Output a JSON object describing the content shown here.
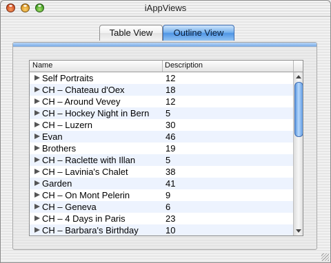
{
  "window": {
    "title": "iAppViews"
  },
  "tabs": {
    "table_label": "Table View",
    "outline_label": "Outline View"
  },
  "table": {
    "columns": [
      "Name",
      "Description"
    ],
    "rows": [
      {
        "name": "Self Portraits",
        "value": "12"
      },
      {
        "name": "CH – Chateau d'Oex",
        "value": "18"
      },
      {
        "name": "CH – Around Vevey",
        "value": "12"
      },
      {
        "name": "CH – Hockey Night in Bern",
        "value": "5"
      },
      {
        "name": "CH – Luzern",
        "value": "30"
      },
      {
        "name": "Evan",
        "value": "46"
      },
      {
        "name": "Brothers",
        "value": "19"
      },
      {
        "name": "CH – Raclette with Illan",
        "value": "5"
      },
      {
        "name": "CH – Lavinia's Chalet",
        "value": "38"
      },
      {
        "name": "Garden",
        "value": "41"
      },
      {
        "name": "CH – On Mont Pelerin",
        "value": "9"
      },
      {
        "name": "CH – Geneva",
        "value": "6"
      },
      {
        "name": "CH – 4 Days in Paris",
        "value": "23"
      },
      {
        "name": "CH – Barbara's Birthday",
        "value": "10"
      }
    ]
  },
  "icons": {
    "close": "close-icon",
    "minimize": "minimize-icon",
    "zoom": "zoom-icon",
    "disclosure": "disclosure-triangle-icon",
    "scroll_up": "arrow-up-icon",
    "scroll_down": "arrow-down-icon",
    "resize": "resize-grip-icon"
  }
}
